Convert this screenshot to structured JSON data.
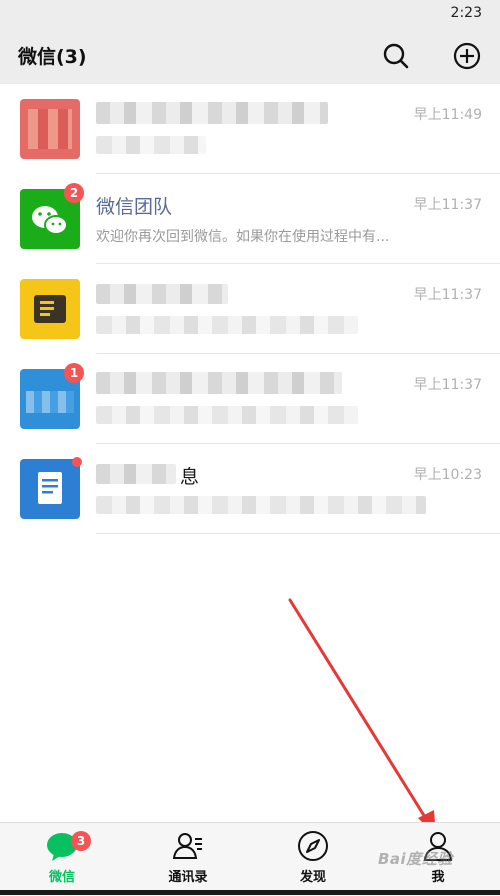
{
  "status_bar": {
    "time": "2:23"
  },
  "header": {
    "title": "微信(3)",
    "search_icon": "search-icon",
    "add_icon": "plus-circle-icon"
  },
  "chats": [
    {
      "name": "",
      "preview": "",
      "time": "早上11:49",
      "badge": ""
    },
    {
      "name": "微信团队",
      "preview": "欢迎你再次回到微信。如果你在使用过程中有...",
      "time": "早上11:37",
      "badge": "2"
    },
    {
      "name": "",
      "preview": "",
      "time": "早上11:37",
      "badge": ""
    },
    {
      "name": "",
      "preview": "",
      "time": "早上11:37",
      "badge": "1"
    },
    {
      "name": "息",
      "preview": "",
      "time": "早上10:23",
      "badge": ""
    }
  ],
  "tabs": [
    {
      "label": "微信",
      "icon": "chat-bubble-icon",
      "badge": "3",
      "active": true
    },
    {
      "label": "通讯录",
      "icon": "contacts-icon"
    },
    {
      "label": "发现",
      "icon": "compass-icon"
    },
    {
      "label": "我",
      "icon": "person-icon"
    }
  ],
  "watermark": "Bai度经验",
  "colors": {
    "accent": "#07c160",
    "badge": "#f45454",
    "arrow": "#e53935"
  }
}
